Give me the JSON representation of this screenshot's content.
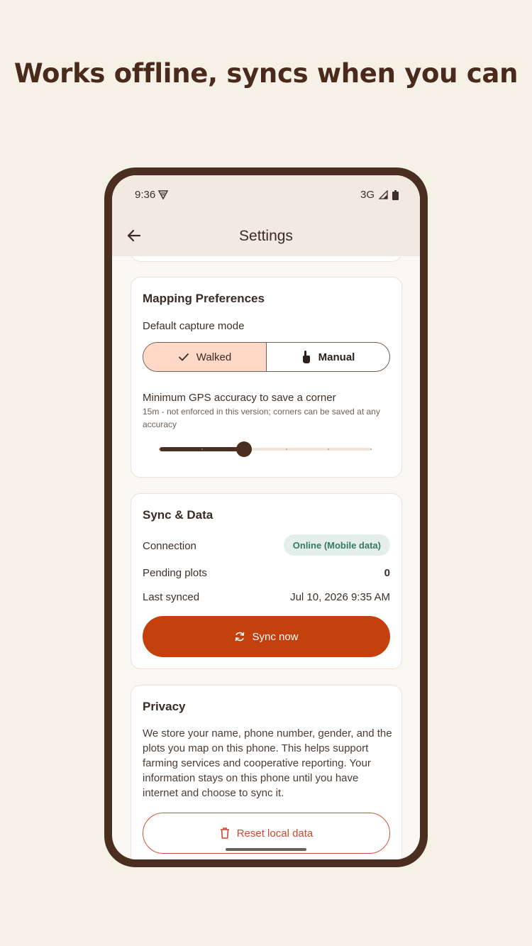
{
  "headline": "Works offline, syncs when you can",
  "status": {
    "time": "9:36",
    "network": "3G"
  },
  "app_bar": {
    "title": "Settings"
  },
  "mapping": {
    "title": "Mapping Preferences",
    "capture_label": "Default capture mode",
    "options": [
      {
        "label": "Walked",
        "selected": true
      },
      {
        "label": "Manual",
        "selected": false
      }
    ],
    "gps_label": "Minimum GPS accuracy to save a corner",
    "gps_hint": "15m - not enforced in this version; corners can be saved at any accuracy",
    "slider_fraction": 0.4,
    "slider_steps": 5
  },
  "sync": {
    "title": "Sync & Data",
    "connection_label": "Connection",
    "connection_value": "Online (Mobile data)",
    "pending_label": "Pending plots",
    "pending_value": "0",
    "last_label": "Last synced",
    "last_value": "Jul 10, 2026 9:35 AM",
    "button": "Sync now"
  },
  "privacy": {
    "title": "Privacy",
    "body": "We store your name, phone number, gender, and the plots you map on this phone. This helps support farming services and cooperative reporting. Your information stays on this phone until you have internet and choose to sync it.",
    "button": "Reset local data"
  },
  "colors": {
    "accent": "#c4410e",
    "brown": "#4a2e1f",
    "success": "#357a62",
    "danger": "#cf4632"
  },
  "icons": [
    "back-arrow-icon",
    "vpn-icon",
    "signal-icon",
    "battery-icon",
    "check-icon",
    "hand-pointer-icon",
    "sync-icon",
    "trash-icon"
  ]
}
